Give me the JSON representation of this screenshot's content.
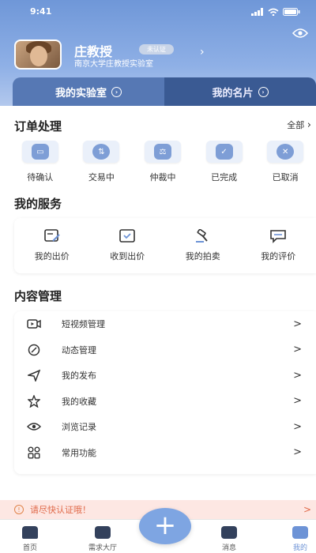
{
  "status_bar": {
    "time": "9:41"
  },
  "profile": {
    "name": "庄教授",
    "badge": "未认证",
    "lab": "南京大学庄教授实验室"
  },
  "cards": [
    {
      "label": "我的实验室"
    },
    {
      "label": "我的名片"
    }
  ],
  "orders": {
    "title": "订单处理",
    "all_label": "全部",
    "items": [
      {
        "label": "待确认",
        "icon": "wallet-icon"
      },
      {
        "label": "交易中",
        "icon": "exchange-icon"
      },
      {
        "label": "仲裁中",
        "icon": "gavel-icon"
      },
      {
        "label": "已完成",
        "icon": "check-clipboard-icon"
      },
      {
        "label": "已取消",
        "icon": "cancel-icon"
      }
    ]
  },
  "services": {
    "title": "我的服务",
    "items": [
      {
        "label": "我的出价",
        "icon": "bid-edit-icon"
      },
      {
        "label": "收到出价",
        "icon": "inbox-check-icon"
      },
      {
        "label": "我的拍卖",
        "icon": "auction-hammer-icon"
      },
      {
        "label": "我的评价",
        "icon": "comment-icon"
      }
    ]
  },
  "content": {
    "title": "内容管理",
    "items": [
      {
        "label": "短视频管理",
        "icon": "video-icon"
      },
      {
        "label": "动态管理",
        "icon": "compass-icon"
      },
      {
        "label": "我的发布",
        "icon": "send-icon"
      },
      {
        "label": "我的收藏",
        "icon": "star-icon"
      },
      {
        "label": "浏览记录",
        "icon": "eye-icon"
      },
      {
        "label": "常用功能",
        "icon": "grid-icon"
      }
    ]
  },
  "notice": {
    "text": "请尽快认证哦！"
  },
  "tabbar": {
    "items": [
      {
        "label": "首页"
      },
      {
        "label": "需求大厅"
      },
      {
        "label": "消息"
      },
      {
        "label": "我的"
      }
    ],
    "plus": "+"
  },
  "colors": {
    "accent": "#6d93d6",
    "header": "#7e9ed6",
    "notice_text": "#e06a4a"
  }
}
